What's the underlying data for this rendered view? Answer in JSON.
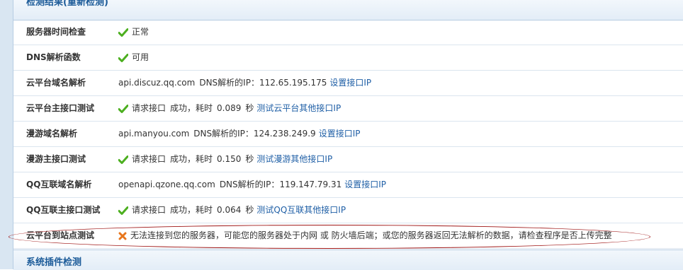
{
  "header": {
    "title": "检测结果(重新检测)"
  },
  "rows": [
    {
      "label": "服务器时间检查",
      "status": "ok",
      "text": "正常"
    },
    {
      "label": "DNS解析函数",
      "status": "ok",
      "text": "可用"
    },
    {
      "label": "云平台域名解析",
      "domain": "api.discuz.qq.com",
      "dns_text": "DNS解析的IP：",
      "ip": "112.65.195.175",
      "link": "设置接口IP"
    },
    {
      "label": "云平台主接口测试",
      "status": "ok",
      "request": "请求接口",
      "result": "成功，耗时",
      "time": "0.089",
      "unit": "秒",
      "link": "测试云平台其他接口IP"
    },
    {
      "label": "漫游域名解析",
      "domain": "api.manyou.com",
      "dns_text": "DNS解析的IP：",
      "ip": "124.238.249.9",
      "link": "设置接口IP"
    },
    {
      "label": "漫游主接口测试",
      "status": "ok",
      "request": "请求接口",
      "result": "成功，耗时",
      "time": "0.150",
      "unit": "秒",
      "link": "测试漫游其他接口IP"
    },
    {
      "label": "QQ互联域名解析",
      "domain": "openapi.qzone.qq.com",
      "dns_text": "DNS解析的IP：",
      "ip": "119.147.79.31",
      "link": "设置接口IP"
    },
    {
      "label": "QQ互联主接口测试",
      "status": "ok",
      "request": "请求接口",
      "result": "成功，耗时",
      "time": "0.064",
      "unit": "秒",
      "link": "测试QQ互联其他接口IP"
    },
    {
      "label": "云平台到站点测试",
      "status": "error",
      "text": "无法连接到您的服务器，可能您的服务器处于内网 或 防火墙后端；或您的服务器返回无法解析的数据，请检查程序是否上传完整"
    }
  ],
  "footer": {
    "title": "系统插件检测"
  },
  "colors": {
    "link": "#1f5fa6",
    "header": "#1c5b99",
    "ok": "#4caf1f",
    "error": "#e8761c",
    "annotation": "#a01818"
  }
}
